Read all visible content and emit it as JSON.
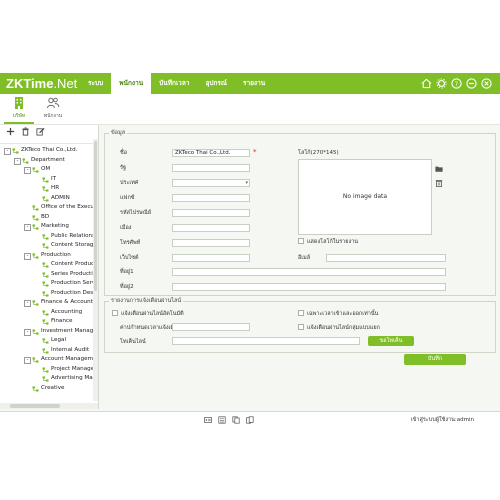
{
  "app": {
    "logo_bold": "ZKTime",
    "logo_light": ".Net"
  },
  "menu": [
    "ระบบ",
    "พนักงาน",
    "บันทึกเวลา",
    "อุปกรณ์",
    "รายงาน"
  ],
  "subtabs": [
    "บริษัท",
    "พนักงาน"
  ],
  "tree": [
    {
      "label": "ZKTeco Thai Co.,Ltd.",
      "level": 0,
      "toggle": "-"
    },
    {
      "label": "Department",
      "level": 1,
      "toggle": "-"
    },
    {
      "label": "OM",
      "level": 2,
      "toggle": "-"
    },
    {
      "label": "IT",
      "level": 3,
      "toggle": ""
    },
    {
      "label": "HR",
      "level": 3,
      "toggle": ""
    },
    {
      "label": "ADMIN",
      "level": 3,
      "toggle": ""
    },
    {
      "label": "Office of the Executive",
      "level": 2,
      "toggle": ""
    },
    {
      "label": "BD",
      "level": 2,
      "toggle": ""
    },
    {
      "label": "Marketing",
      "level": 2,
      "toggle": "-"
    },
    {
      "label": "Public Relations",
      "level": 3,
      "toggle": ""
    },
    {
      "label": "Content Storage",
      "level": 3,
      "toggle": ""
    },
    {
      "label": "Production",
      "level": 2,
      "toggle": "-"
    },
    {
      "label": "Content Production",
      "level": 3,
      "toggle": ""
    },
    {
      "label": "Series Production",
      "level": 3,
      "toggle": ""
    },
    {
      "label": "Production Service",
      "level": 3,
      "toggle": ""
    },
    {
      "label": "Production Design",
      "level": 3,
      "toggle": ""
    },
    {
      "label": "Finance & Accounting",
      "level": 2,
      "toggle": "-"
    },
    {
      "label": "Accounting",
      "level": 3,
      "toggle": ""
    },
    {
      "label": "Finance",
      "level": 3,
      "toggle": ""
    },
    {
      "label": "Investment Management",
      "level": 2,
      "toggle": "-"
    },
    {
      "label": "Legal",
      "level": 3,
      "toggle": ""
    },
    {
      "label": "Internal Audit",
      "level": 3,
      "toggle": ""
    },
    {
      "label": "Account Management",
      "level": 2,
      "toggle": "-"
    },
    {
      "label": "Project Management",
      "level": 3,
      "toggle": ""
    },
    {
      "label": "Advertising Management",
      "level": 3,
      "toggle": ""
    },
    {
      "label": "Creative",
      "level": 2,
      "toggle": ""
    }
  ],
  "info": {
    "legend": "ข้อมูล",
    "name_label": "ชื่อ",
    "name_value": "ZKTeco Thai Co.,Ltd.",
    "tax_label": "รัฐ",
    "country_label": "ประเทศ",
    "fax_label": "แฟกซ์",
    "postcode_label": "รหัสไปรษณีย์",
    "city_label": "เมือง",
    "phone_label": "โทรศัพท์",
    "website_label": "เว็บไซต์",
    "address1_label": "ที่อยู่1",
    "address2_label": "ที่อยู่2",
    "logo_label": "โลโก้(270*145)",
    "no_image": "No image data",
    "show_logo_label": "แสดงโลโก้ในรายงาน",
    "email_label": "อีเมล์"
  },
  "notify": {
    "legend": "รายงานการแจ้งเตือนผ่านไลน์",
    "auto_line": "แจ้งเตือนผ่านไลน์อัตโนมัติ",
    "late_only": "เฉพาะเวลาเข้าและออกเท่านั้น",
    "time_label": "ค่าปกำหนดเวลาแจ้งเตือน",
    "line_group": "แจ้งเตือนผ่านไลน์กลุ่มแบบแยก",
    "token_label": "โทเค็นไลน์",
    "token_button": "ขอโทเค็น"
  },
  "save_button": "บันทึก",
  "status": {
    "user_text": "เข้าสู่ระบบผู้ใช้งาน:admin"
  }
}
